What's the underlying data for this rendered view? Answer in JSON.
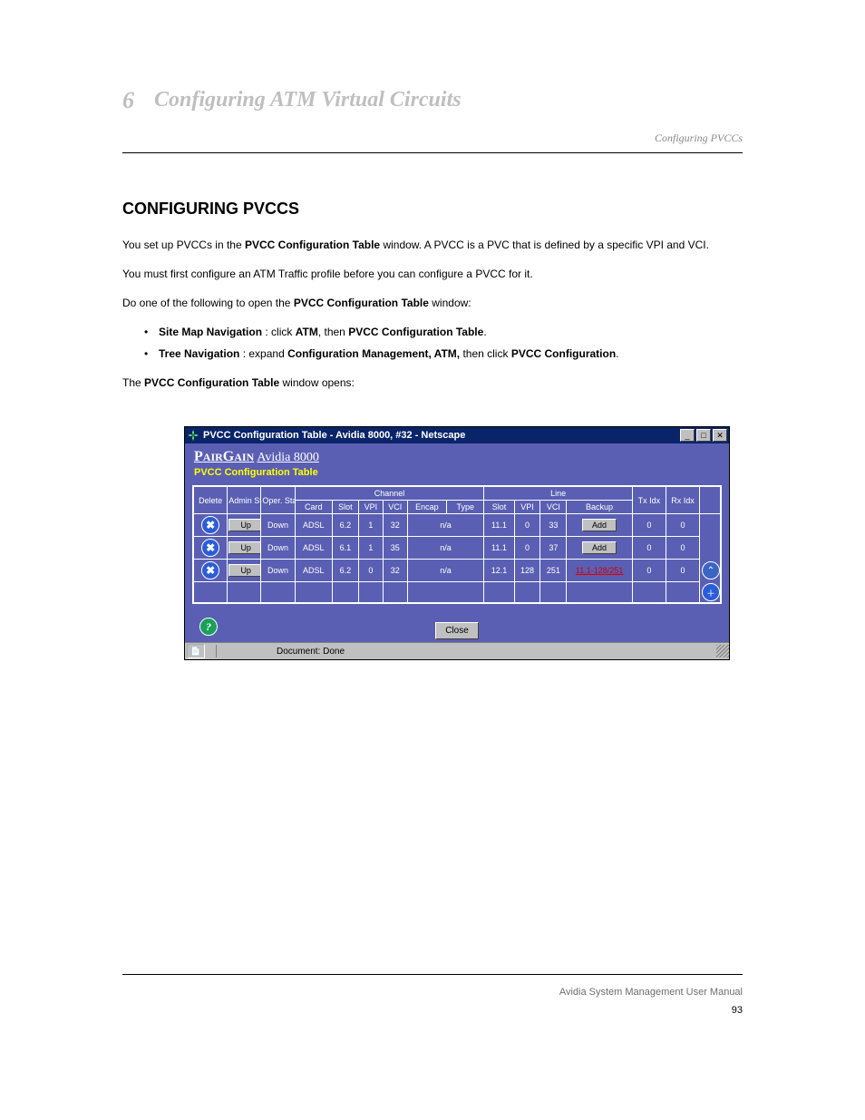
{
  "header": {
    "section_num": "6",
    "section_title": "Configuring ATM Virtual Circuits",
    "subhead": "Configuring PVCCs"
  },
  "text": {
    "heading": "CONFIGURING PVCCS",
    "p1a": "You set up PVCCs in the",
    "pvcc_table": "PVCC Configuration Table",
    "p1b": "window. A PVCC is a PVC that is defined by a specific VPI and VCI.",
    "p2": "You must first configure an ATM Traffic profile before you can configure a PVCC for it.",
    "open1": "Do one of the following to open the",
    "open2": "window:",
    "sitemap_b": "Site Map Navigation",
    "sitemap_p1": ": click",
    "atm_b": "ATM",
    "sitemap_p2": ", then",
    "treenav_b": "Tree Navigation",
    "treenav_p1": ": expand",
    "cma": "Configuration Management, ATM,",
    "treenav_p2": "then click",
    "pvcc_config": "PVCC Configuration",
    "period": ".",
    "open3a": "The",
    "open3b": "window opens:"
  },
  "shot": {
    "title": "PVCC Configuration Table - Avidia 8000, #32 - Netscape",
    "brand1a": "AIR",
    "brand1b": "AIN",
    "brand2": " Avidia 8000",
    "subtitle": "PVCC Configuration Table",
    "close_label": "Close",
    "status": "Document: Done",
    "headers": {
      "delete": "Delete",
      "admin": "Admin Status",
      "oper": "Oper. Status",
      "channel": "Channel",
      "line": "Line",
      "card": "Card",
      "slot": "Slot",
      "vpi": "VPI",
      "vci": "VCI",
      "encap": "Encap",
      "type": "Type",
      "backup": "Backup",
      "txidx": "Tx Idx",
      "rxidx": "Rx Idx"
    },
    "rows": [
      {
        "admin": "Up",
        "oper": "Down",
        "card": "ADSL",
        "cslot": "6.2",
        "cvpi": "1",
        "cvci": "32",
        "encap": "n/a",
        "lslot": "11.1",
        "lvpi": "0",
        "lvci": "33",
        "backup": "Add",
        "tx": "0",
        "rx": "0"
      },
      {
        "admin": "Up",
        "oper": "Down",
        "card": "ADSL",
        "cslot": "6.1",
        "cvpi": "1",
        "cvci": "35",
        "encap": "n/a",
        "lslot": "11.1",
        "lvpi": "0",
        "lvci": "37",
        "backup": "Add",
        "tx": "0",
        "rx": "0"
      },
      {
        "admin": "Up",
        "oper": "Down",
        "card": "ADSL",
        "cslot": "6.2",
        "cvpi": "0",
        "cvci": "32",
        "encap": "n/a",
        "lslot": "12.1",
        "lvpi": "128",
        "lvci": "251",
        "backup": "11.1-128/251",
        "tx": "0",
        "rx": "0"
      }
    ]
  },
  "footer": {
    "running": "Avidia System Management User Manual",
    "pagenum": "93"
  }
}
